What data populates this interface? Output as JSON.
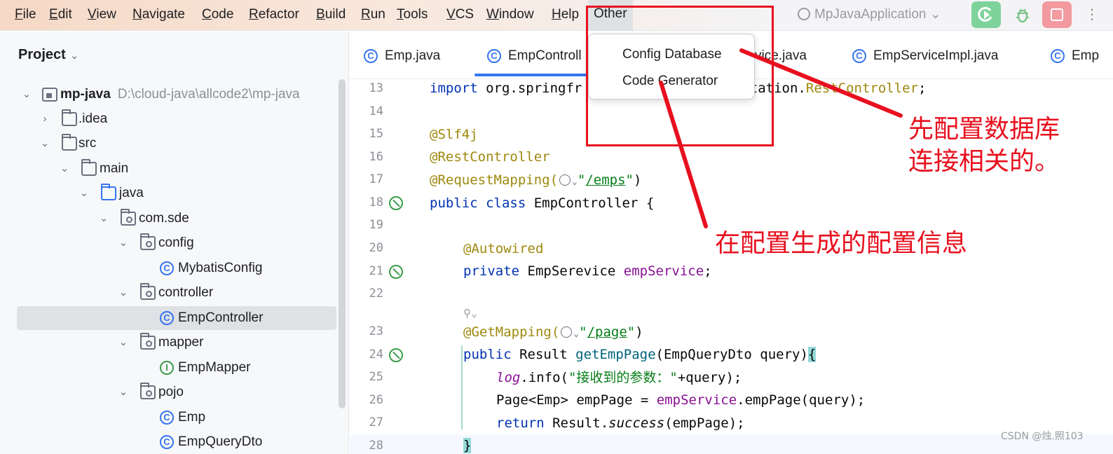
{
  "menubar": {
    "items": [
      {
        "mn": "F",
        "rest": "ile"
      },
      {
        "mn": "E",
        "rest": "dit"
      },
      {
        "mn": "V",
        "rest": "iew"
      },
      {
        "mn": "N",
        "rest": "avigate"
      },
      {
        "mn": "C",
        "rest": "ode"
      },
      {
        "mn": "R",
        "rest": "efactor"
      },
      {
        "mn": "B",
        "rest": "uild"
      },
      {
        "mn": "R",
        "rest": "un"
      },
      {
        "mn": "T",
        "rest": "ools"
      },
      {
        "mn": "V",
        "rest": "CS"
      },
      {
        "mn": "W",
        "rest": "indow"
      },
      {
        "mn": "H",
        "rest": "elp"
      }
    ],
    "open_item": "Other",
    "run_config": "MpJavaApplication ⌄"
  },
  "project": {
    "title": "Project",
    "tree": [
      {
        "label": "mp-java",
        "path": "D:\\cloud-java\\allcode2\\mp-java"
      },
      {
        "label": ".idea"
      },
      {
        "label": "src"
      },
      {
        "label": "main"
      },
      {
        "label": "java"
      },
      {
        "label": "com.sde"
      },
      {
        "label": "config"
      },
      {
        "label": "MybatisConfig"
      },
      {
        "label": "controller"
      },
      {
        "label": "EmpController"
      },
      {
        "label": "mapper"
      },
      {
        "label": "EmpMapper"
      },
      {
        "label": "pojo"
      },
      {
        "label": "Emp"
      },
      {
        "label": "EmpQueryDto"
      }
    ]
  },
  "tabs": [
    "Emp.java",
    "EmpControll",
    "vice.java",
    "EmpServiceImpl.java",
    "Emp"
  ],
  "editor": {
    "line_numbers": [
      "13",
      "14",
      "15",
      "16",
      "17",
      "18",
      "19",
      "20",
      "21",
      "22",
      "23",
      "24",
      "25",
      "26",
      "27",
      "28"
    ]
  },
  "code": {
    "l13a": "import ",
    "l13b": "org.springfr",
    "l13c": "otation.",
    "l13d": "RestController",
    "l13e": ";",
    "l15": "@Slf4j",
    "l16": "@RestController",
    "l17a": "@RequestMapping(",
    "l17b": "\"",
    "l17c": "/emps",
    "l17d": "\"",
    "l17e": ")",
    "l18a": "public class ",
    "l18b": "EmpController {",
    "l20": "@Autowired",
    "l21a": "private ",
    "l21b": "EmpSerevice ",
    "l21c": "empService",
    "l21d": ";",
    "l23a": "@GetMapping(",
    "l23b": "\"",
    "l23c": "/page",
    "l23d": "\"",
    "l23e": ")",
    "l24a": "public ",
    "l24b": "Result ",
    "l24c": "getEmpPage",
    "l24d": "(EmpQueryDto query)",
    "l24e": "{",
    "l25a": "log",
    "l25b": ".info(",
    "l25c": "\"接收到的参数：\"",
    "l25d": "+query);",
    "l26a": "Page<Emp> empPage = ",
    "l26b": "empService",
    "l26c": ".empPage(query);",
    "l27a": "return ",
    "l27b": "Result.",
    "l27c": "success",
    "l27d": "(empPage);",
    "l28": "}"
  },
  "dropdown": {
    "items": [
      "Config Database",
      "Code Generator"
    ]
  },
  "annotations": {
    "text1_line1": "先配置数据库",
    "text1_line2": "连接相关的。",
    "text2": "在配置生成的配置信息"
  },
  "watermark": "CSDN @烛.照103",
  "colors": {
    "annotation": "#e8101e",
    "accent": "#3574f0",
    "run_button": "#7ed39a",
    "stop_button": "#f29aa0"
  }
}
